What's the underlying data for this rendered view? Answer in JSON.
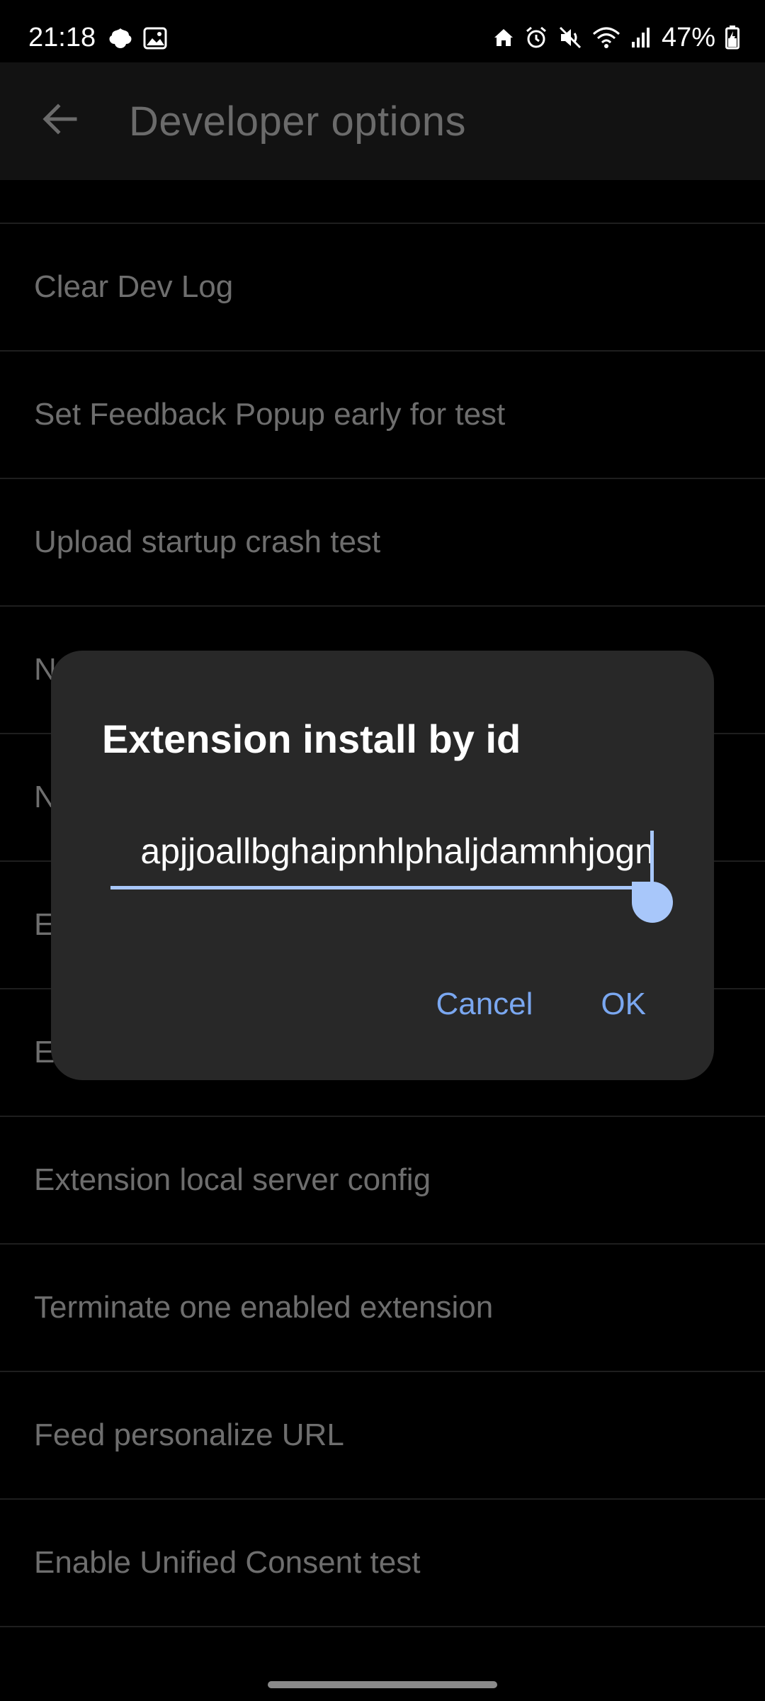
{
  "status_bar": {
    "time": "21:18",
    "battery": "47%",
    "left_icons": [
      "notification-app-icon",
      "gallery-icon"
    ],
    "right_icons": [
      "home-icon",
      "alarm-icon",
      "mute-icon",
      "wifi-icon",
      "signal-icon",
      "battery-icon"
    ]
  },
  "app_bar": {
    "title": "Developer options",
    "back_icon": "arrow-back-icon"
  },
  "list": {
    "items": [
      "Clear Dev Log",
      "Set Feedback Popup early for test",
      "Upload startup crash test",
      "N",
      "N",
      "E",
      "E",
      "Extension local server config",
      "Terminate one enabled extension",
      "Feed personalize URL",
      "Enable Unified Consent test"
    ]
  },
  "dialog": {
    "title": "Extension install by id",
    "input_value": "apjjoallbghaipnhlphaljdamnhjogn",
    "cancel_label": "Cancel",
    "ok_label": "OK"
  },
  "colors": {
    "background": "#000000",
    "app_bar": "#121212",
    "dialog": "#282828",
    "accent": "#a8c7fa",
    "button_text": "#7aa7f0",
    "list_text": "#6e6e6e"
  }
}
